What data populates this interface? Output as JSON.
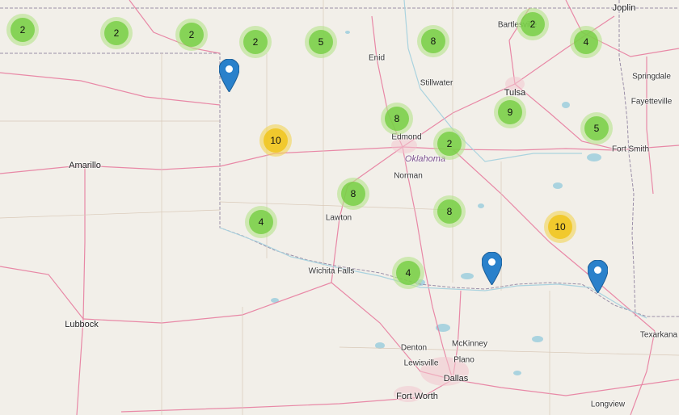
{
  "map": {
    "colors": {
      "land": "#f2efe9",
      "road": "#e7779b",
      "water": "#aad3df",
      "border": "#9b8fa8",
      "cluster_small": "#6ecc39",
      "cluster_medium": "#f0c20c",
      "marker": "#2a81cb"
    },
    "labels": [
      {
        "name": "Joplin",
        "type": "city"
      },
      {
        "name": "Bartlesville",
        "type": "town"
      },
      {
        "name": "Enid",
        "type": "town"
      },
      {
        "name": "Stillwater",
        "type": "town"
      },
      {
        "name": "Tulsa",
        "type": "city"
      },
      {
        "name": "Springdale",
        "type": "town"
      },
      {
        "name": "Fayetteville",
        "type": "town"
      },
      {
        "name": "Edmond",
        "type": "town"
      },
      {
        "name": "Oklahoma",
        "type": "state"
      },
      {
        "name": "Norman",
        "type": "town"
      },
      {
        "name": "Fort Smith",
        "type": "town"
      },
      {
        "name": "Amarillo",
        "type": "city"
      },
      {
        "name": "Lawton",
        "type": "town"
      },
      {
        "name": "Wichita Falls",
        "type": "town"
      },
      {
        "name": "Lubbock",
        "type": "city"
      },
      {
        "name": "Texarkana",
        "type": "town"
      },
      {
        "name": "McKinney",
        "type": "town"
      },
      {
        "name": "Denton",
        "type": "town"
      },
      {
        "name": "Plano",
        "type": "town"
      },
      {
        "name": "Lewisville",
        "type": "town"
      },
      {
        "name": "Dallas",
        "type": "city"
      },
      {
        "name": "Fort Worth",
        "type": "city"
      },
      {
        "name": "Longview",
        "type": "town"
      }
    ],
    "clusters": [
      {
        "count": "2",
        "size": "small"
      },
      {
        "count": "2",
        "size": "small"
      },
      {
        "count": "2",
        "size": "small"
      },
      {
        "count": "2",
        "size": "small"
      },
      {
        "count": "5",
        "size": "small"
      },
      {
        "count": "8",
        "size": "small"
      },
      {
        "count": "2",
        "size": "small"
      },
      {
        "count": "4",
        "size": "small"
      },
      {
        "count": "10",
        "size": "medium"
      },
      {
        "count": "8",
        "size": "small"
      },
      {
        "count": "9",
        "size": "small"
      },
      {
        "count": "5",
        "size": "small"
      },
      {
        "count": "2",
        "size": "small"
      },
      {
        "count": "8",
        "size": "small"
      },
      {
        "count": "4",
        "size": "small"
      },
      {
        "count": "8",
        "size": "small"
      },
      {
        "count": "10",
        "size": "medium"
      },
      {
        "count": "4",
        "size": "small"
      }
    ],
    "markers": [
      {
        "icon": "map-pin-icon"
      },
      {
        "icon": "map-pin-icon"
      },
      {
        "icon": "map-pin-icon"
      }
    ]
  }
}
